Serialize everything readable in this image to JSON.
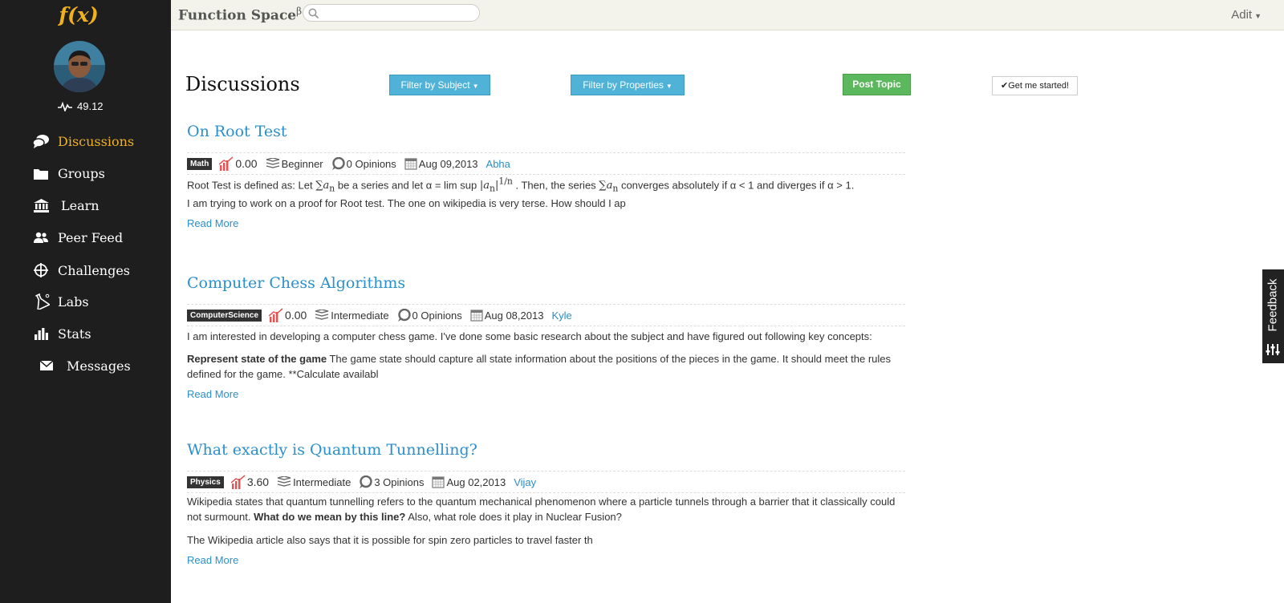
{
  "app": {
    "logo": "f(x)",
    "brand": "Function Space",
    "brand_sup": "β",
    "search": {
      "placeholder": "",
      "value": ""
    },
    "user_menu": "Adit"
  },
  "sidebar": {
    "score": "49.12",
    "items": [
      {
        "label": "Discussions",
        "icon": "speech-bubbles-icon",
        "active": true
      },
      {
        "label": "Groups",
        "icon": "folder-icon"
      },
      {
        "label": "Learn",
        "icon": "institution-icon"
      },
      {
        "label": "Peer Feed",
        "icon": "users-icon"
      },
      {
        "label": "Challenges",
        "icon": "crosshair-icon"
      },
      {
        "label": "Labs",
        "icon": "flask-icon"
      },
      {
        "label": "Stats",
        "icon": "bar-chart-icon"
      },
      {
        "label": "Messages",
        "icon": "envelope-icon"
      }
    ]
  },
  "main": {
    "title": "Discussions",
    "filter_subject": "Filter by Subject",
    "filter_properties": "Filter by Properties",
    "post_topic": "Post Topic",
    "get_started": "Get me started!"
  },
  "posts": [
    {
      "title": "On Root Test",
      "tag": "Math",
      "rating": "0.00",
      "level": "Beginner",
      "opinions": "0 Opinions",
      "date": "Aug 09,2013",
      "author": "Abha",
      "p1_a": "Root Test is defined as: Let ",
      "p1_b": " be a series and let α = lim sup ",
      "p1_c": " . Then, the series ",
      "p1_d": " converges absolutely if α < 1 and diverges if α > 1.",
      "p2": "I am trying to work on a proof for Root test. The one on wikipedia is very terse. How should I ap",
      "read_more": "Read More"
    },
    {
      "title": "Computer Chess Algorithms",
      "tag": "ComputerScience",
      "rating": "0.00",
      "level": "Intermediate",
      "opinions": "0 Opinions",
      "date": "Aug 08,2013",
      "author": "Kyle",
      "p1": "I am interested in developing a computer chess game. I've done some basic research about the subject and have figured out following key concepts:",
      "p2_bold": "Represent state of the game",
      "p2": " The game state should capture all state information about the positions of the pieces in the game. It should meet the rules defined for the game. **Calculate availabl",
      "read_more": "Read More"
    },
    {
      "title": "What exactly is Quantum Tunnelling?",
      "tag": "Physics",
      "rating": "3.60",
      "level": "Intermediate",
      "opinions": "3 Opinions",
      "date": "Aug 02,2013",
      "author": "Vijay",
      "p1_a": "Wikipedia states that quantum tunnelling refers to the quantum mechanical phenomenon where a particle tunnels through a barrier that it classically could not surmount. ",
      "p1_bold": "What do we mean by this line?",
      "p1_b": " Also, what role does it play in Nuclear Fusion?",
      "p2": "The Wikipedia article also says that it is possible for spin zero particles to travel faster th",
      "read_more": "Read More"
    }
  ],
  "feedback_label": "Feedback",
  "colors": {
    "sidebar_bg": "#1e1e1e",
    "accent": "#f0b020",
    "link": "#2a8fcc",
    "filter_button": "#4fb2d6",
    "post_button": "#5cb85c"
  }
}
